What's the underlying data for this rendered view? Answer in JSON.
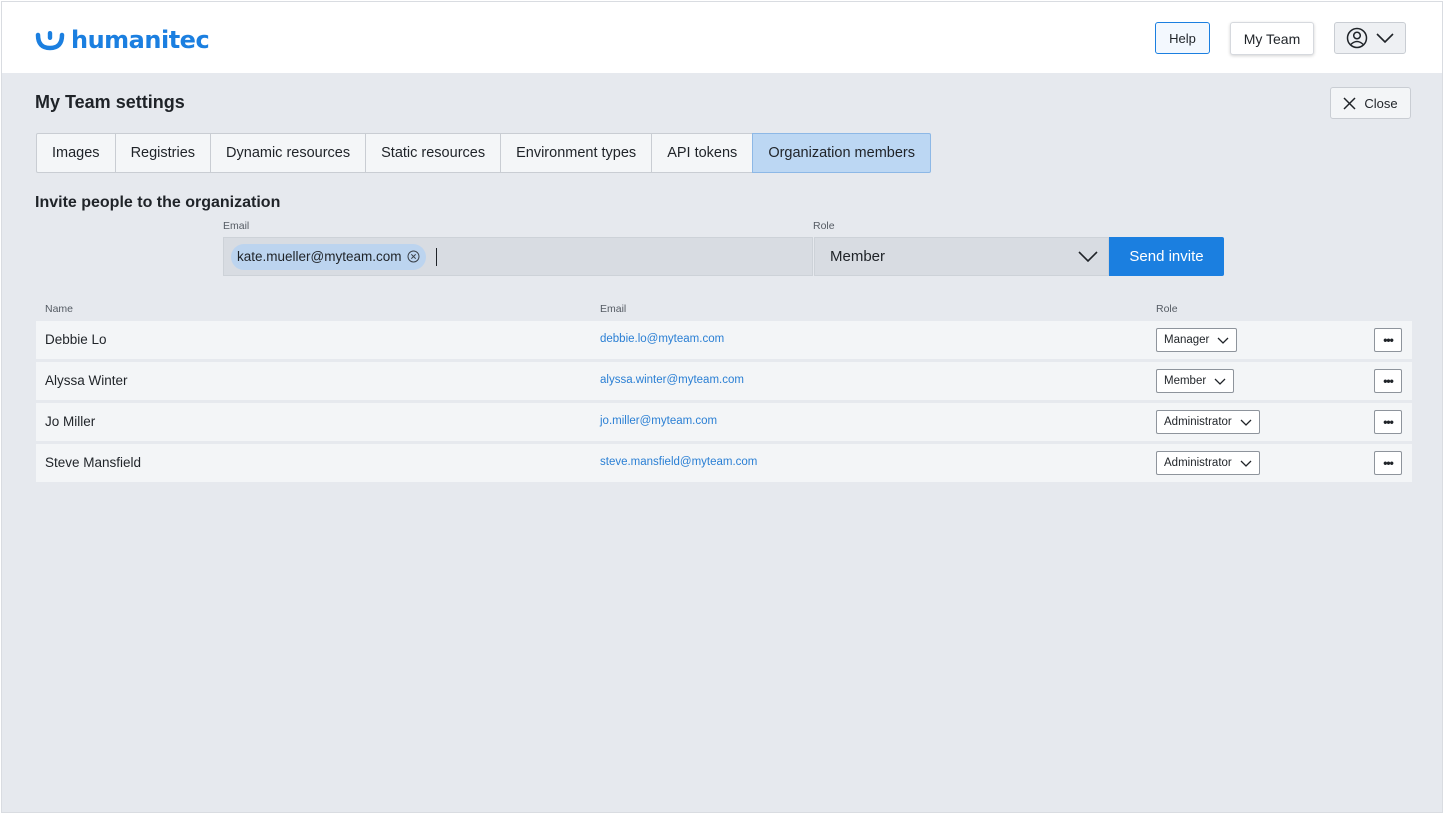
{
  "header": {
    "logo_text": "humanitec",
    "help_label": "Help",
    "team_label": "My Team",
    "brand_color": "#1b7fe0"
  },
  "page": {
    "title": "My Team settings",
    "close_label": "Close"
  },
  "tabs": [
    {
      "label": "Images",
      "active": false
    },
    {
      "label": "Registries",
      "active": false
    },
    {
      "label": "Dynamic resources",
      "active": false
    },
    {
      "label": "Static resources",
      "active": false
    },
    {
      "label": "Environment types",
      "active": false
    },
    {
      "label": "API tokens",
      "active": false
    },
    {
      "label": "Organization members",
      "active": true
    }
  ],
  "invite": {
    "title": "Invite people to the organization",
    "email_label": "Email",
    "email_chips": [
      "kate.mueller@myteam.com"
    ],
    "role_label": "Role",
    "role_value": "Member",
    "send_label": "Send invite"
  },
  "members": {
    "columns": {
      "name": "Name",
      "email": "Email",
      "role": "Role"
    },
    "more_label": "•••",
    "rows": [
      {
        "name": "Debbie Lo",
        "email": "debbie.lo@myteam.com",
        "role": "Manager"
      },
      {
        "name": "Alyssa Winter",
        "email": "alyssa.winter@myteam.com",
        "role": "Member"
      },
      {
        "name": "Jo Miller",
        "email": "jo.miller@myteam.com",
        "role": "Administrator"
      },
      {
        "name": "Steve Mansfield",
        "email": "steve.mansfield@myteam.com",
        "role": "Administrator"
      }
    ]
  }
}
